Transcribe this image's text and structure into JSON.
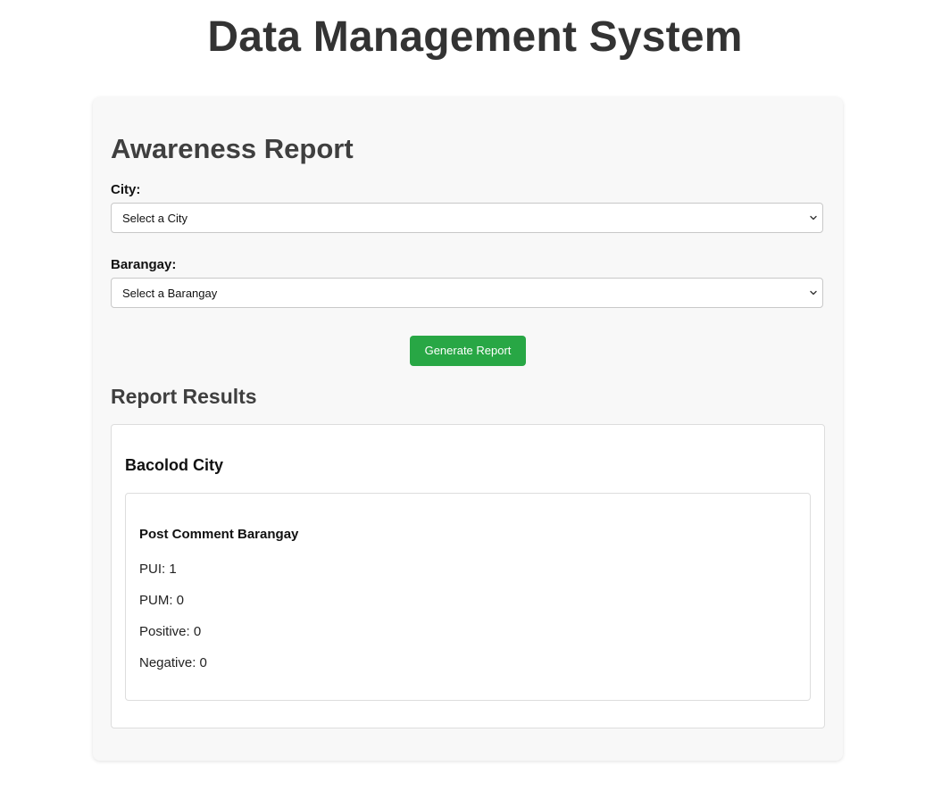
{
  "header": {
    "title": "Data Management System"
  },
  "report": {
    "title": "Awareness Report",
    "city_label": "City:",
    "city_select": {
      "selected": "Select a City"
    },
    "barangay_label": "Barangay:",
    "barangay_select": {
      "selected": "Select a Barangay"
    },
    "generate_button": "Generate Report"
  },
  "results": {
    "title": "Report Results",
    "city": {
      "name": "Bacolod City",
      "barangays": [
        {
          "name": "Post Comment Barangay",
          "stats": [
            {
              "text": "PUI: 1"
            },
            {
              "text": "PUM: 0"
            },
            {
              "text": "Positive: 0"
            },
            {
              "text": "Negative: 0"
            }
          ]
        }
      ]
    }
  },
  "colors": {
    "accent_button": "#28a745",
    "card_bg": "#f8f8f8",
    "title_text": "#333333"
  },
  "icons": {
    "select_arrow": "chevron-down-icon"
  }
}
